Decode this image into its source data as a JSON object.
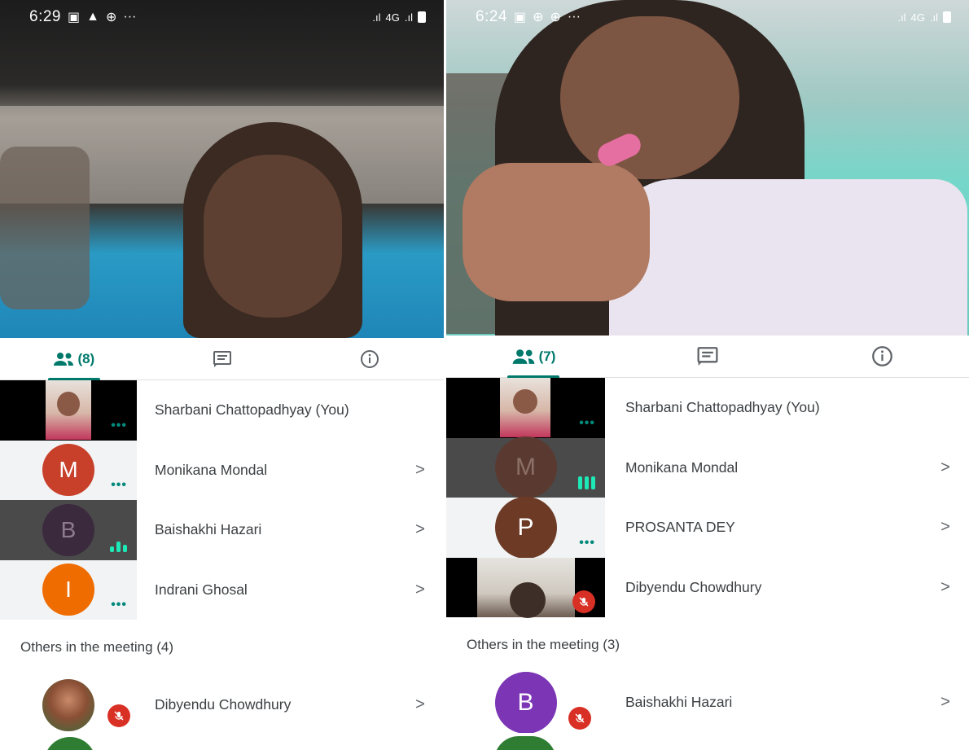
{
  "left": {
    "status": {
      "time": "6:29",
      "icons": [
        "image-icon",
        "warning-icon",
        "vpn-icon",
        "more-icon"
      ],
      "signal_text": "4G"
    },
    "tabs": {
      "people_count": "(8)",
      "active": "people"
    },
    "participants": [
      {
        "name": "Sharbani Chattopadhyay (You)",
        "type": "video",
        "indicator": "dots"
      },
      {
        "name": "Monikana Mondal",
        "initial": "M",
        "color": "#c8402a",
        "indicator": "dots",
        "chevron": ">"
      },
      {
        "name": "Baishakhi Hazari",
        "initial": "B",
        "color": "#3b2a3d",
        "indicator": "bars",
        "dark": true,
        "chevron": ">"
      },
      {
        "name": "Indrani Ghosal",
        "initial": "I",
        "color": "#ef6c00",
        "indicator": "dots",
        "chevron": ">"
      }
    ],
    "others_label": "Others in the meeting (4)",
    "others": [
      {
        "name": "Dibyendu Chowdhury",
        "type": "photo",
        "muted": true,
        "chevron": ">"
      }
    ]
  },
  "right": {
    "status": {
      "time": "6:24",
      "icons": [
        "image-icon",
        "vpn-icon",
        "vpn-icon",
        "more-icon"
      ],
      "signal_text": "4G"
    },
    "tabs": {
      "people_count": "(7)",
      "active": "people"
    },
    "participants": [
      {
        "name": "Sharbani Chattopadhyay (You)",
        "type": "video",
        "indicator": "dots"
      },
      {
        "name": "Monikana Mondal",
        "initial": "M",
        "color": "#5a3a30",
        "indicator": "bars",
        "dark": true,
        "chevron": ">"
      },
      {
        "name": "PROSANTA DEY",
        "initial": "P",
        "color": "#6d3a26",
        "indicator": "dots",
        "chevron": ">"
      },
      {
        "name": "Dibyendu Chowdhury",
        "type": "video",
        "muted": true,
        "chevron": ">"
      }
    ],
    "others_label": "Others in the meeting (3)",
    "others": [
      {
        "name": "Baishakhi Hazari",
        "initial": "B",
        "color": "#7b35b5",
        "muted": true,
        "chevron": ">"
      }
    ]
  },
  "colors": {
    "accent": "#00796b",
    "dots": "#00897b",
    "bars": "#1de9b6",
    "mute": "#d93025"
  },
  "dots_glyph": "•••"
}
